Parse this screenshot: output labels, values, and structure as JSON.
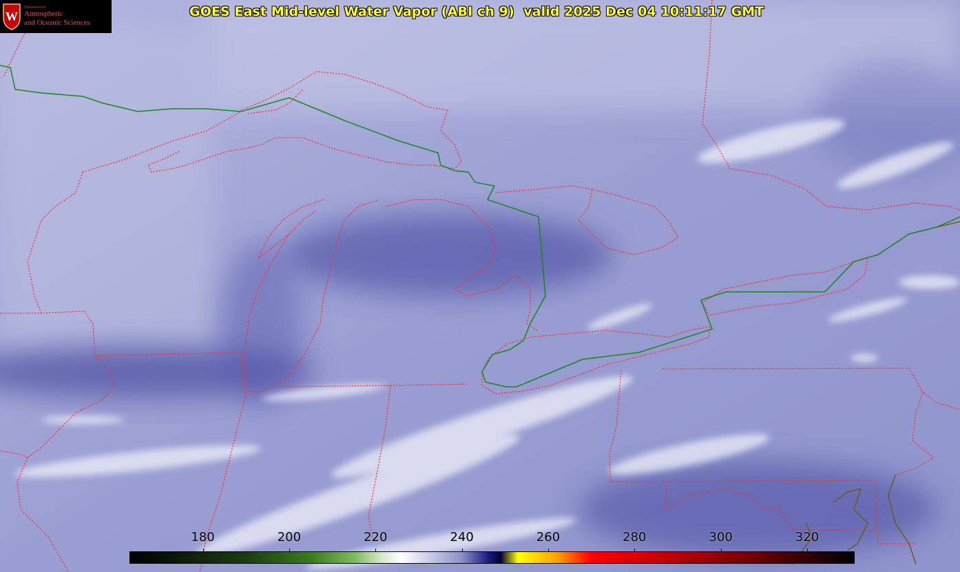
{
  "title": "GOES East Mid-level Water Vapor (ABI ch 9)  valid 2025 Dec 04 10:11:17 GMT",
  "logo": {
    "small_text": "Department of",
    "line1": "Atmospheric",
    "line2": "and Oceanic Sciences",
    "crest_letter": "W"
  },
  "colorbar": {
    "tick_labels": [
      "180",
      "200",
      "220",
      "240",
      "260",
      "280",
      "300",
      "320"
    ],
    "tick_values": [
      180,
      200,
      220,
      240,
      260,
      280,
      300,
      320
    ],
    "range": [
      163,
      331
    ],
    "stops": [
      {
        "v": 163,
        "c": "#000000"
      },
      {
        "v": 190,
        "c": "#1b3d12"
      },
      {
        "v": 205,
        "c": "#3a7a22"
      },
      {
        "v": 215,
        "c": "#7dba5a"
      },
      {
        "v": 221,
        "c": "#d2e6c4"
      },
      {
        "v": 226,
        "c": "#ffffff"
      },
      {
        "v": 240,
        "c": "#8c90c6"
      },
      {
        "v": 246,
        "c": "#1c1d82"
      },
      {
        "v": 249,
        "c": "#000035"
      },
      {
        "v": 253,
        "c": "#ffff00"
      },
      {
        "v": 262,
        "c": "#ffa500"
      },
      {
        "v": 270,
        "c": "#ff0000"
      },
      {
        "v": 285,
        "c": "#cc0000"
      },
      {
        "v": 305,
        "c": "#7a0000"
      },
      {
        "v": 331,
        "c": "#000000"
      }
    ]
  },
  "colors": {
    "state_borders": "#ff2a2a",
    "international_border": "#138a1b",
    "coastline": "#6b5a1e",
    "vapor_base": "#9a9fd2",
    "vapor_dark": "#3a3f99",
    "vapor_light": "#e4e6f4"
  }
}
